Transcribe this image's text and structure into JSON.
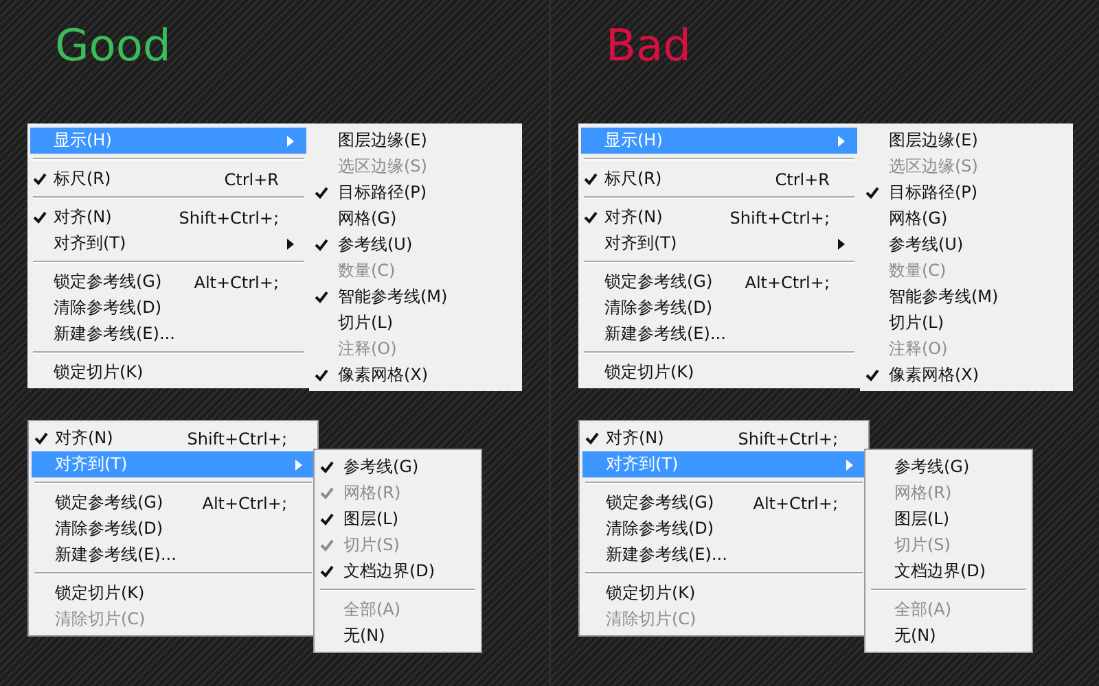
{
  "panels": [
    {
      "title": "Good",
      "color": "#3dba5a",
      "menus": [
        {
          "items": [
            {
              "kind": "item",
              "label": "显示(H)",
              "selected": true,
              "checked": false,
              "disabled": false,
              "arrow": true
            },
            {
              "kind": "separator"
            },
            {
              "kind": "item",
              "label": "标尺(R)",
              "shortcut": "Ctrl+R",
              "selected": false,
              "checked": true,
              "disabled": false,
              "arrow": false
            },
            {
              "kind": "separator"
            },
            {
              "kind": "item",
              "label": "对齐(N)",
              "shortcut": "Shift+Ctrl+;",
              "selected": false,
              "checked": true,
              "disabled": false,
              "arrow": false
            },
            {
              "kind": "item",
              "label": "对齐到(T)",
              "selected": false,
              "checked": false,
              "disabled": false,
              "arrow": true
            },
            {
              "kind": "separator"
            },
            {
              "kind": "item",
              "label": "锁定参考线(G)",
              "shortcut": "Alt+Ctrl+;",
              "selected": false,
              "checked": false,
              "disabled": false,
              "arrow": false
            },
            {
              "kind": "item",
              "label": "清除参考线(D)",
              "selected": false,
              "checked": false,
              "disabled": false,
              "arrow": false
            },
            {
              "kind": "item",
              "label": "新建参考线(E)...",
              "selected": false,
              "checked": false,
              "disabled": false,
              "arrow": false
            },
            {
              "kind": "separator"
            },
            {
              "kind": "item",
              "label": "锁定切片(K)",
              "selected": false,
              "checked": false,
              "disabled": false,
              "arrow": false
            }
          ],
          "submenu": {
            "items": [
              {
                "kind": "item",
                "label": "图层边缘(E)",
                "checked": false,
                "disabled": false
              },
              {
                "kind": "item",
                "label": "选区边缘(S)",
                "checked": false,
                "disabled": true
              },
              {
                "kind": "item",
                "label": "目标路径(P)",
                "checked": true,
                "disabled": false
              },
              {
                "kind": "item",
                "label": "网格(G)",
                "checked": false,
                "disabled": false
              },
              {
                "kind": "item",
                "label": "参考线(U)",
                "checked": true,
                "disabled": false
              },
              {
                "kind": "item",
                "label": "数量(C)",
                "checked": false,
                "disabled": true
              },
              {
                "kind": "item",
                "label": "智能参考线(M)",
                "checked": true,
                "disabled": false
              },
              {
                "kind": "item",
                "label": "切片(L)",
                "checked": false,
                "disabled": false
              },
              {
                "kind": "item",
                "label": "注释(O)",
                "checked": false,
                "disabled": true
              },
              {
                "kind": "item",
                "label": "像素网格(X)",
                "checked": true,
                "disabled": false
              }
            ]
          }
        },
        {
          "items": [
            {
              "kind": "item",
              "label": "对齐(N)",
              "shortcut": "Shift+Ctrl+;",
              "selected": false,
              "checked": true,
              "disabled": false,
              "arrow": false
            },
            {
              "kind": "item",
              "label": "对齐到(T)",
              "selected": true,
              "checked": false,
              "disabled": false,
              "arrow": true
            },
            {
              "kind": "separator"
            },
            {
              "kind": "item",
              "label": "锁定参考线(G)",
              "shortcut": "Alt+Ctrl+;",
              "selected": false,
              "checked": false,
              "disabled": false,
              "arrow": false
            },
            {
              "kind": "item",
              "label": "清除参考线(D)",
              "selected": false,
              "checked": false,
              "disabled": false,
              "arrow": false
            },
            {
              "kind": "item",
              "label": "新建参考线(E)...",
              "selected": false,
              "checked": false,
              "disabled": false,
              "arrow": false
            },
            {
              "kind": "separator"
            },
            {
              "kind": "item",
              "label": "锁定切片(K)",
              "selected": false,
              "checked": false,
              "disabled": false,
              "arrow": false
            },
            {
              "kind": "item",
              "label": "清除切片(C)",
              "selected": false,
              "checked": false,
              "disabled": true,
              "arrow": false
            }
          ],
          "submenu": {
            "items": [
              {
                "kind": "item",
                "label": "参考线(G)",
                "checked": true,
                "disabled": false
              },
              {
                "kind": "item",
                "label": "网格(R)",
                "checked": true,
                "disabled": true
              },
              {
                "kind": "item",
                "label": "图层(L)",
                "checked": true,
                "disabled": false
              },
              {
                "kind": "item",
                "label": "切片(S)",
                "checked": true,
                "disabled": true
              },
              {
                "kind": "item",
                "label": "文档边界(D)",
                "checked": true,
                "disabled": false
              },
              {
                "kind": "separator"
              },
              {
                "kind": "item",
                "label": "全部(A)",
                "checked": false,
                "disabled": true
              },
              {
                "kind": "item",
                "label": "无(N)",
                "checked": false,
                "disabled": false
              }
            ]
          }
        }
      ]
    },
    {
      "title": "Bad",
      "color": "#d8103f",
      "menus": [
        {
          "items": [
            {
              "kind": "item",
              "label": "显示(H)",
              "selected": true,
              "checked": false,
              "disabled": false,
              "arrow": true
            },
            {
              "kind": "separator"
            },
            {
              "kind": "item",
              "label": "标尺(R)",
              "shortcut": "Ctrl+R",
              "selected": false,
              "checked": true,
              "disabled": false,
              "arrow": false
            },
            {
              "kind": "separator"
            },
            {
              "kind": "item",
              "label": "对齐(N)",
              "shortcut": "Shift+Ctrl+;",
              "selected": false,
              "checked": true,
              "disabled": false,
              "arrow": false
            },
            {
              "kind": "item",
              "label": "对齐到(T)",
              "selected": false,
              "checked": false,
              "disabled": false,
              "arrow": true
            },
            {
              "kind": "separator"
            },
            {
              "kind": "item",
              "label": "锁定参考线(G)",
              "shortcut": "Alt+Ctrl+;",
              "selected": false,
              "checked": false,
              "disabled": false,
              "arrow": false
            },
            {
              "kind": "item",
              "label": "清除参考线(D)",
              "selected": false,
              "checked": false,
              "disabled": false,
              "arrow": false
            },
            {
              "kind": "item",
              "label": "新建参考线(E)...",
              "selected": false,
              "checked": false,
              "disabled": false,
              "arrow": false
            },
            {
              "kind": "separator"
            },
            {
              "kind": "item",
              "label": "锁定切片(K)",
              "selected": false,
              "checked": false,
              "disabled": false,
              "arrow": false
            }
          ],
          "submenu": {
            "items": [
              {
                "kind": "item",
                "label": "图层边缘(E)",
                "checked": false,
                "disabled": false
              },
              {
                "kind": "item",
                "label": "选区边缘(S)",
                "checked": false,
                "disabled": true
              },
              {
                "kind": "item",
                "label": "目标路径(P)",
                "checked": true,
                "disabled": false
              },
              {
                "kind": "item",
                "label": "网格(G)",
                "checked": false,
                "disabled": false
              },
              {
                "kind": "item",
                "label": "参考线(U)",
                "checked": false,
                "disabled": false
              },
              {
                "kind": "item",
                "label": "数量(C)",
                "checked": false,
                "disabled": true
              },
              {
                "kind": "item",
                "label": "智能参考线(M)",
                "checked": false,
                "disabled": false
              },
              {
                "kind": "item",
                "label": "切片(L)",
                "checked": false,
                "disabled": false
              },
              {
                "kind": "item",
                "label": "注释(O)",
                "checked": false,
                "disabled": true
              },
              {
                "kind": "item",
                "label": "像素网格(X)",
                "checked": true,
                "disabled": false
              }
            ]
          }
        },
        {
          "items": [
            {
              "kind": "item",
              "label": "对齐(N)",
              "shortcut": "Shift+Ctrl+;",
              "selected": false,
              "checked": true,
              "disabled": false,
              "arrow": false
            },
            {
              "kind": "item",
              "label": "对齐到(T)",
              "selected": true,
              "checked": false,
              "disabled": false,
              "arrow": true
            },
            {
              "kind": "separator"
            },
            {
              "kind": "item",
              "label": "锁定参考线(G)",
              "shortcut": "Alt+Ctrl+;",
              "selected": false,
              "checked": false,
              "disabled": false,
              "arrow": false
            },
            {
              "kind": "item",
              "label": "清除参考线(D)",
              "selected": false,
              "checked": false,
              "disabled": false,
              "arrow": false
            },
            {
              "kind": "item",
              "label": "新建参考线(E)...",
              "selected": false,
              "checked": false,
              "disabled": false,
              "arrow": false
            },
            {
              "kind": "separator"
            },
            {
              "kind": "item",
              "label": "锁定切片(K)",
              "selected": false,
              "checked": false,
              "disabled": false,
              "arrow": false
            },
            {
              "kind": "item",
              "label": "清除切片(C)",
              "selected": false,
              "checked": false,
              "disabled": true,
              "arrow": false
            }
          ],
          "submenu": {
            "items": [
              {
                "kind": "item",
                "label": "参考线(G)",
                "checked": false,
                "disabled": false
              },
              {
                "kind": "item",
                "label": "网格(R)",
                "checked": false,
                "disabled": true
              },
              {
                "kind": "item",
                "label": "图层(L)",
                "checked": false,
                "disabled": false
              },
              {
                "kind": "item",
                "label": "切片(S)",
                "checked": false,
                "disabled": true
              },
              {
                "kind": "item",
                "label": "文档边界(D)",
                "checked": false,
                "disabled": false
              },
              {
                "kind": "separator"
              },
              {
                "kind": "item",
                "label": "全部(A)",
                "checked": false,
                "disabled": true
              },
              {
                "kind": "item",
                "label": "无(N)",
                "checked": false,
                "disabled": false
              }
            ]
          }
        }
      ]
    }
  ]
}
